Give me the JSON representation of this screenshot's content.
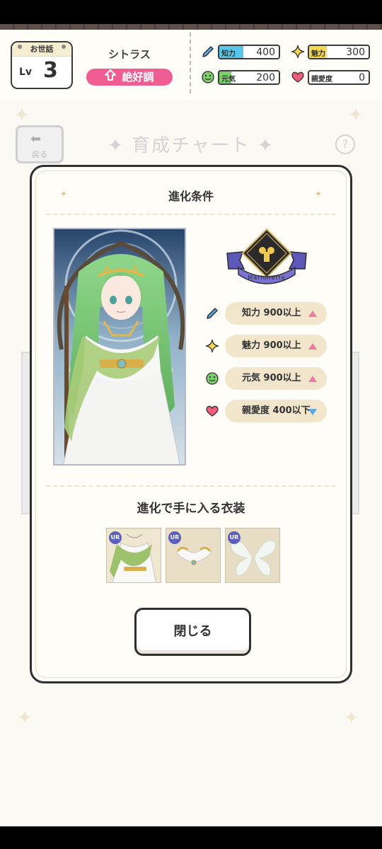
{
  "header": {
    "care_label": "お世話",
    "level_prefix": "Lv",
    "level_value": "3",
    "character_name": "シトラス",
    "mood_label": "絶好調",
    "stats": [
      {
        "label": "知力",
        "value": "400",
        "icon": "pencil-icon",
        "color": "#58c6e8",
        "fill_fraction": 0.4
      },
      {
        "label": "魅力",
        "value": "300",
        "icon": "sparkle-icon",
        "color": "#f7d84a",
        "fill_fraction": 0.3
      },
      {
        "label": "元気",
        "value": "200",
        "icon": "smile-icon",
        "color": "#7ccf6a",
        "fill_fraction": 0.2
      },
      {
        "label": "親愛度",
        "value": "0",
        "icon": "heart-icon",
        "color": "#ef5d7a",
        "fill_fraction": 0.0
      }
    ]
  },
  "background": {
    "back_label": "戻る",
    "screen_title": "育成チャート",
    "help_symbol": "?"
  },
  "dialog": {
    "title": "進化条件",
    "emblem_label": "Marionette",
    "conditions": [
      {
        "text": "知力 900以上",
        "icon": "pencil-icon",
        "direction": "up"
      },
      {
        "text": "魅力 900以上",
        "icon": "sparkle-icon",
        "direction": "up"
      },
      {
        "text": "元気 900以上",
        "icon": "smile-icon",
        "direction": "up"
      },
      {
        "text": "親愛度 400以下",
        "icon": "heart-icon",
        "direction": "down"
      }
    ],
    "costume_title": "進化で手に入る衣装",
    "costume_items": [
      {
        "rarity": "UR",
        "name": "green-shawl-costume"
      },
      {
        "rarity": "UR",
        "name": "gold-collar-costume"
      },
      {
        "rarity": "UR",
        "name": "fairy-wings-costume"
      }
    ],
    "close_label": "閉じる"
  },
  "colors": {
    "accent_pink": "#ef5d92",
    "pill_bg": "#f1e6cc",
    "up_arrow": "#ef7aa0",
    "down_arrow": "#5aa7e8"
  }
}
